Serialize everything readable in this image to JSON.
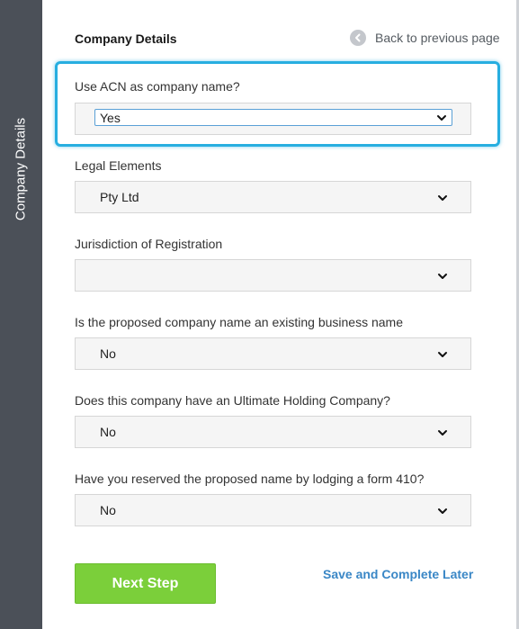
{
  "sidebar": {
    "label": "Company Details"
  },
  "header": {
    "title": "Company Details",
    "back_label": "Back to previous page"
  },
  "fields": [
    {
      "label": "Use ACN as company name?",
      "value": "Yes"
    },
    {
      "label": "Legal Elements",
      "value": "Pty Ltd"
    },
    {
      "label": "Jurisdiction of Registration",
      "value": ""
    },
    {
      "label": "Is the proposed company name an existing business name",
      "value": "No"
    },
    {
      "label": "Does this company have an Ultimate Holding Company?",
      "value": "No"
    },
    {
      "label": "Have you reserved the proposed name by lodging a form 410?",
      "value": "No"
    }
  ],
  "actions": {
    "next_label": "Next Step",
    "save_label": "Save and Complete Later"
  },
  "colors": {
    "sidebar": "#4b5058",
    "highlight": "#27aee0",
    "primary_button": "#7bcf3a",
    "link": "#3a87c6"
  }
}
